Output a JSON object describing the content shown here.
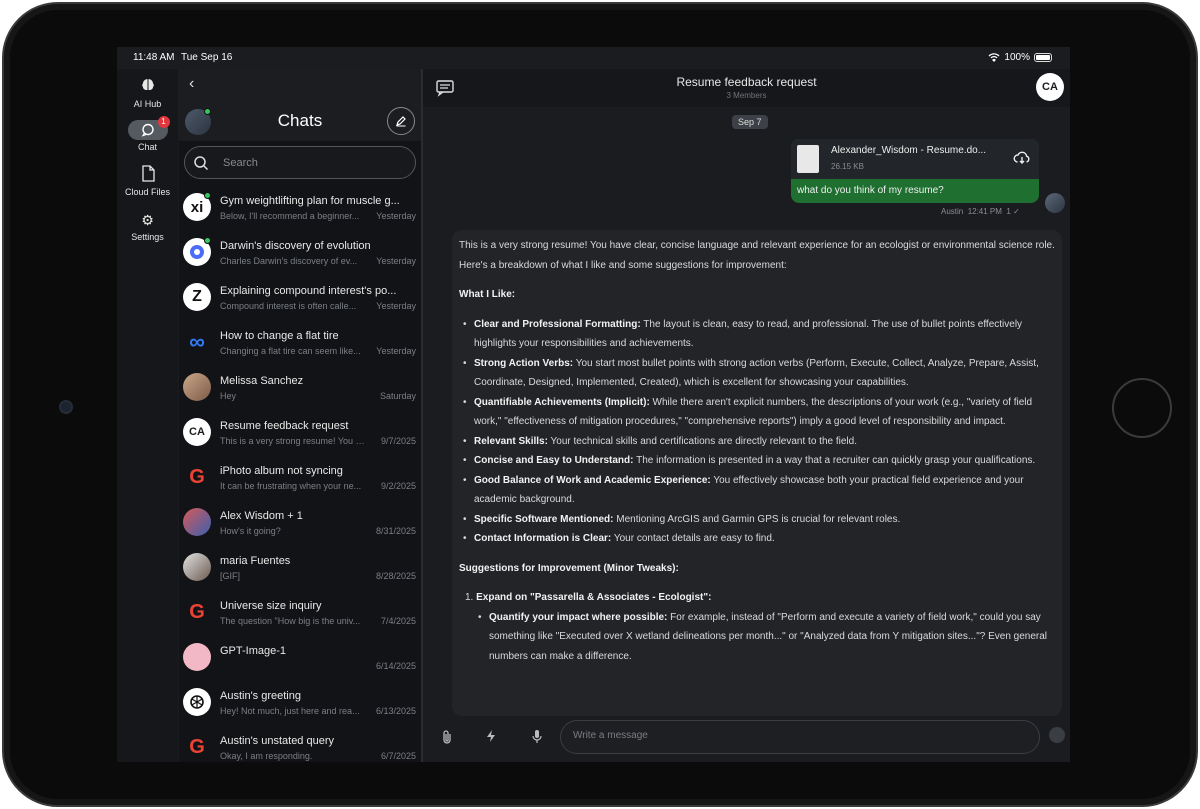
{
  "status_bar": {
    "time": "11:48 AM",
    "date": "Tue Sep 16",
    "battery": "100%"
  },
  "rail": {
    "items": [
      {
        "label": "AI Hub",
        "icon": "brain-icon"
      },
      {
        "label": "Chat",
        "icon": "chat-bubble-icon",
        "badge": "1"
      },
      {
        "label": "Cloud Files",
        "icon": "file-icon"
      },
      {
        "label": "Settings",
        "icon": "gear-icon"
      }
    ]
  },
  "chat_list": {
    "title": "Chats",
    "search_placeholder": "Search",
    "items": [
      {
        "title": "Gym weightlifting plan for muscle g...",
        "preview": "Below, I'll recommend a beginner...",
        "date": "Yesterday",
        "avatar": "xi"
      },
      {
        "title": "Darwin's discovery of evolution",
        "preview": "Charles Darwin's discovery of ev...",
        "date": "Yesterday",
        "avatar": ""
      },
      {
        "title": "Explaining compound interest's po...",
        "preview": "Compound interest is often calle...",
        "date": "Yesterday",
        "avatar": "Z"
      },
      {
        "title": "How to change a flat tire",
        "preview": "Changing a flat tire can seem like...",
        "date": "Yesterday",
        "avatar": "∞"
      },
      {
        "title": "Melissa Sanchez",
        "preview": "Hey",
        "date": "Saturday",
        "avatar": ""
      },
      {
        "title": "Resume feedback request",
        "preview": "This is a very strong resume! You h...",
        "date": "9/7/2025",
        "avatar": "CA"
      },
      {
        "title": "iPhoto album not syncing",
        "preview": "It can be frustrating when your ne...",
        "date": "9/2/2025",
        "avatar": "G"
      },
      {
        "title": "Alex Wisdom + 1",
        "preview": "How's it going?",
        "date": "8/31/2025",
        "avatar": ""
      },
      {
        "title": "maria Fuentes",
        "preview": "[GIF]",
        "date": "8/28/2025",
        "avatar": ""
      },
      {
        "title": "Universe size inquiry",
        "preview": "The question \"How big is the univ...",
        "date": "7/4/2025",
        "avatar": "G"
      },
      {
        "title": "GPT-Image-1",
        "preview": "",
        "date": "6/14/2025",
        "avatar": ""
      },
      {
        "title": "Austin's greeting",
        "preview": "Hey! Not much, just here and rea...",
        "date": "6/13/2025",
        "avatar": ""
      },
      {
        "title": "Austin's unstated query",
        "preview": "Okay, I am responding.",
        "date": "6/7/2025",
        "avatar": "G"
      }
    ]
  },
  "conversation": {
    "title": "Resume feedback request",
    "subtitle": "3 Members",
    "avatar": "CA",
    "date_chip": "Sep 7",
    "sent": {
      "file_name": "Alexander_Wisdom - Resume.do...",
      "file_size": "26.15 KB",
      "text": "what do you think of my resume?",
      "sender": "Austin",
      "time": "12:41 PM",
      "read_count": "1"
    },
    "reply": {
      "intro": "This is a very strong resume! You have clear, concise language and relevant experience for an ecologist or environmental science role. Here's a breakdown of what I like and some suggestions for improvement:",
      "likes_heading": "What I Like:",
      "likes": [
        {
          "bold": "Clear and Professional Formatting:",
          "text": " The layout is clean, easy to read, and professional. The use of bullet points effectively highlights your responsibilities and achievements."
        },
        {
          "bold": "Strong Action Verbs:",
          "text": " You start most bullet points with strong action verbs (Perform, Execute, Collect, Analyze, Prepare, Assist, Coordinate, Designed, Implemented, Created), which is excellent for showcasing your capabilities."
        },
        {
          "bold": "Quantifiable Achievements (Implicit):",
          "text": " While there aren't explicit numbers, the descriptions of your work (e.g., \"variety of field work,\" \"effectiveness of mitigation procedures,\" \"comprehensive reports\") imply a good level of responsibility and impact."
        },
        {
          "bold": "Relevant Skills:",
          "text": " Your technical skills and certifications are directly relevant to the field."
        },
        {
          "bold": "Concise and Easy to Understand:",
          "text": " The information is presented in a way that a recruiter can quickly grasp your qualifications."
        },
        {
          "bold": "Good Balance of Work and Academic Experience:",
          "text": " You effectively showcase both your practical field experience and your academic background."
        },
        {
          "bold": "Specific Software Mentioned:",
          "text": " Mentioning ArcGIS and Garmin GPS is crucial for relevant roles."
        },
        {
          "bold": "Contact Information is Clear:",
          "text": " Your contact details are easy to find."
        }
      ],
      "suggestions_heading": "Suggestions for Improvement (Minor Tweaks):",
      "suggestion_1_number": "1.",
      "suggestion_1_title": "Expand on \"Passarella & Associates - Ecologist\":",
      "suggestion_1_sub_bold": "Quantify your impact where possible:",
      "suggestion_1_sub_text": " For example, instead of \"Perform and execute a variety of field work,\" could you say something like \"Executed over X wetland delineations per month...\" or \"Analyzed data from Y mitigation sites...\"? Even general numbers can make a difference."
    },
    "composer_placeholder": "Write a message"
  },
  "colors": {
    "accent_green": "#1f6f30",
    "badge_red": "#e0363c",
    "online_green": "#34c759"
  }
}
